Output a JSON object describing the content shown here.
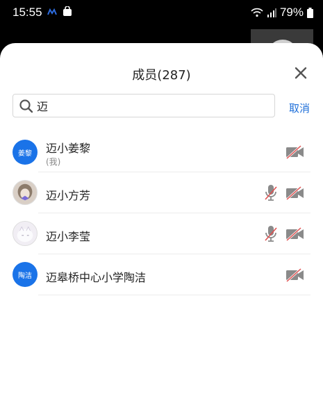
{
  "status_bar": {
    "time": "15:55",
    "battery": "79%",
    "icons": [
      "app-notification-icon",
      "shopping-bag-icon",
      "wifi-icon",
      "signal-icon",
      "battery-icon"
    ]
  },
  "dialog": {
    "title": "成员(287)",
    "close_icon": "close-icon"
  },
  "search": {
    "value": "迈",
    "icon": "search-icon",
    "cancel_label": "取消"
  },
  "members": [
    {
      "name": "迈小姜黎",
      "note": "(我)",
      "avatar_text": "姜黎",
      "avatar_type": "text",
      "mic_muted": false,
      "video_off": true
    },
    {
      "name": "迈小方芳",
      "note": "",
      "avatar_text": "",
      "avatar_type": "image",
      "mic_muted": true,
      "video_off": true
    },
    {
      "name": "迈小李莹",
      "note": "",
      "avatar_text": "",
      "avatar_type": "image",
      "mic_muted": true,
      "video_off": true
    },
    {
      "name": "迈皋桥中心小学陶洁",
      "note": "",
      "avatar_text": "陶洁",
      "avatar_type": "text",
      "mic_muted": false,
      "video_off": true
    }
  ],
  "colors": {
    "accent": "#1e6fd9",
    "avatar_blue": "#1a73e8",
    "muted_red": "#e05050",
    "icon_gray": "#8a8a8a"
  }
}
